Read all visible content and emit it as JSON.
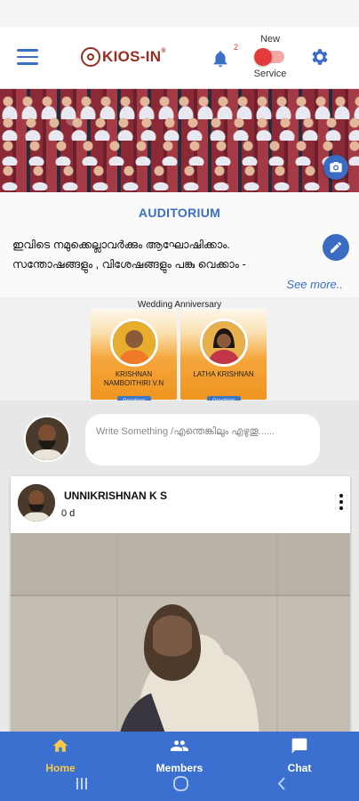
{
  "app": {
    "logo_text": "KIOS-IN",
    "logo_trademark": "®",
    "notification_count": "2",
    "toggle_top_label": "New",
    "toggle_bottom_label": "Service"
  },
  "info": {
    "title": "AUDITORIUM",
    "description_line1": "ഇവിടെ നമുക്കെല്ലാവർക്കും ആഘോഷിക്കാം.",
    "description_line2": "സന്തോഷങ്ങളും , വിശേഷങ്ങളും പങ്കു വെക്കാം -",
    "see_more": "See more.."
  },
  "events": {
    "title": "Wedding Anniversary",
    "cards": [
      {
        "name": "KRISHNAN NAMBOITHIRI V.N",
        "button": "Greetings"
      },
      {
        "name": "LATHA KRISHNAN",
        "button": "Greetings"
      }
    ]
  },
  "composer": {
    "placeholder": "Write Something /എന്തെങ്കിലും എഴുതൂ......"
  },
  "post": {
    "author": "UNNIKRISHNAN K S",
    "time": "0 d"
  },
  "bottom_nav": [
    {
      "label": "Home",
      "icon": "home-icon",
      "active": true
    },
    {
      "label": "Members",
      "icon": "members-icon",
      "active": false
    },
    {
      "label": "Chat",
      "icon": "chat-icon",
      "active": false
    }
  ],
  "colors": {
    "primary": "#3b6fd0",
    "active_nav": "#f7c948",
    "brand": "#9b2d20",
    "toggle_off": "#e53a3a"
  }
}
